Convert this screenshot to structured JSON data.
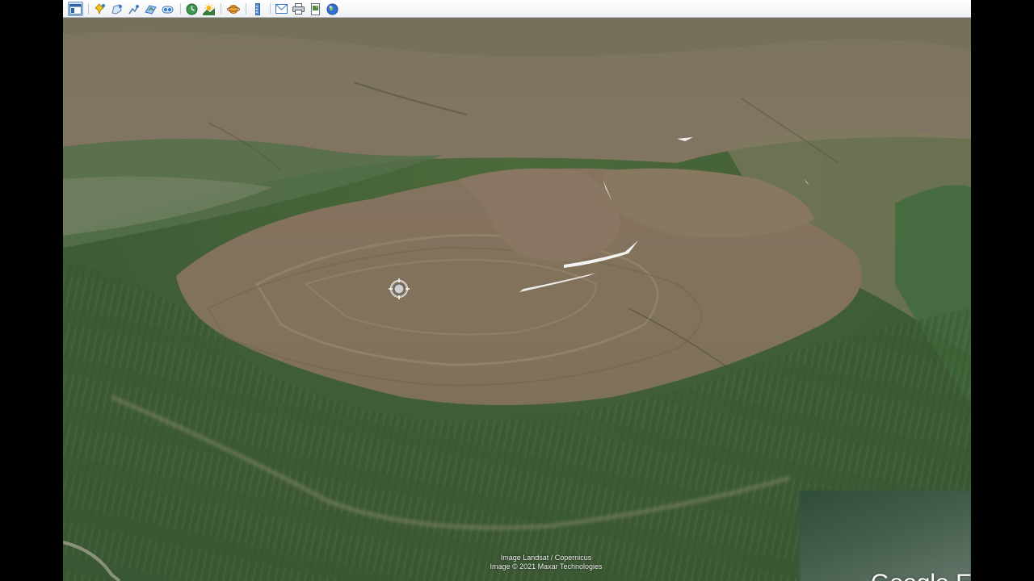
{
  "toolbar": {
    "buttons": [
      {
        "name": "sidebar-toggle-button",
        "icon": "sidebar-icon",
        "tooltip": "Hide Sidebar"
      },
      {
        "name": "add-placemark-button",
        "icon": "pushpin-icon",
        "tooltip": "Add Placemark"
      },
      {
        "name": "add-polygon-button",
        "icon": "polygon-icon",
        "tooltip": "Add Polygon"
      },
      {
        "name": "add-path-button",
        "icon": "path-icon",
        "tooltip": "Add Path"
      },
      {
        "name": "add-overlay-button",
        "icon": "overlay-icon",
        "tooltip": "Add Image Overlay"
      },
      {
        "name": "record-tour-button",
        "icon": "tour-icon",
        "tooltip": "Record a Tour"
      },
      {
        "name": "historical-imagery-button",
        "icon": "clock-icon",
        "tooltip": "Show historical imagery"
      },
      {
        "name": "sunlight-button",
        "icon": "sun-icon",
        "tooltip": "Show sunlight across the landscape"
      },
      {
        "name": "switch-planet-button",
        "icon": "planet-icon",
        "tooltip": "Switch between Earth, Sky and other planets"
      },
      {
        "name": "ruler-button",
        "icon": "ruler-icon",
        "tooltip": "Show Ruler"
      },
      {
        "name": "email-button",
        "icon": "envelope-icon",
        "tooltip": "Email"
      },
      {
        "name": "print-button",
        "icon": "printer-icon",
        "tooltip": "Print"
      },
      {
        "name": "save-image-button",
        "icon": "image-icon",
        "tooltip": "Save Image"
      },
      {
        "name": "view-in-maps-button",
        "icon": "globe-icon",
        "tooltip": "View in Google Maps"
      }
    ]
  },
  "map": {
    "attribution_line1": "Image Landsat / Copernicus",
    "attribution_line2": "Image © 2021 Maxar Technologies",
    "logo_text": "Google Earth"
  },
  "colors": {
    "toolbar_accent": "#3a78c8",
    "terrain_brown": "#86745f",
    "terrain_green": "#3f5f37"
  }
}
